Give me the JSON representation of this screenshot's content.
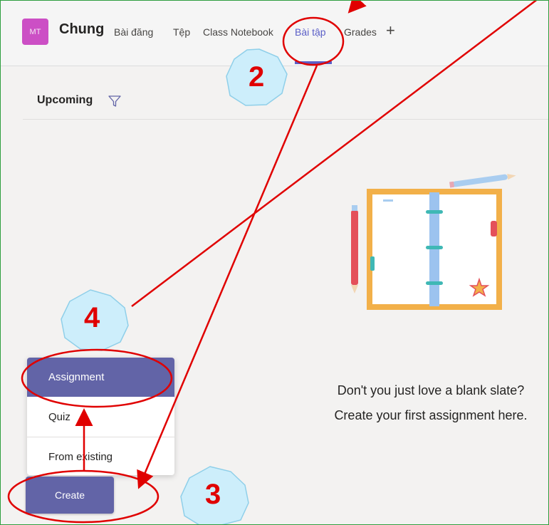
{
  "header": {
    "avatar_initials": "MT",
    "team_name": "Chung",
    "tabs": [
      {
        "label": "Bài đăng"
      },
      {
        "label": "Tệp"
      },
      {
        "label": "Class Notebook"
      },
      {
        "label": "Bài tập",
        "active": true
      },
      {
        "label": "Grades"
      }
    ],
    "add_tab_symbol": "+"
  },
  "toolbar": {
    "filter_label": "Upcoming"
  },
  "empty_state": {
    "line1": "Don't you just love a blank slate?",
    "line2": "Create your first assignment here."
  },
  "create_menu": {
    "items": [
      {
        "label": "Assignment",
        "selected": true
      },
      {
        "label": "Quiz"
      },
      {
        "label": "From existing"
      }
    ]
  },
  "create_button": {
    "label": "Create"
  },
  "annotations": {
    "steps": [
      "2",
      "3",
      "4"
    ]
  },
  "colors": {
    "accent": "#6264a7",
    "avatar": "#cc4fc5",
    "annotation": "#e00000",
    "badge": "#cdeefb"
  }
}
